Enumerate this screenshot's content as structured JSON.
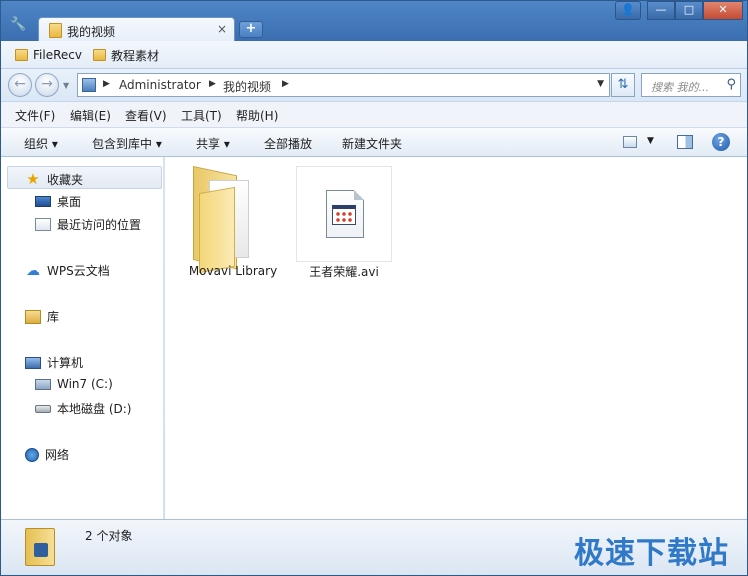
{
  "tab": {
    "title": "我的视频",
    "close": "×"
  },
  "new_tab": "+",
  "caption": {
    "user": "👤",
    "minimize": "—",
    "maximize": "□",
    "close": "✕"
  },
  "favorites": [
    {
      "label": "FileRecv"
    },
    {
      "label": "教程素材"
    }
  ],
  "address": {
    "crumbs": [
      "Administrator",
      "我的视频"
    ],
    "search_placeholder": "搜索 我的..."
  },
  "menu": [
    "文件(F)",
    "编辑(E)",
    "查看(V)",
    "工具(T)",
    "帮助(H)"
  ],
  "toolbar": {
    "organize": "组织",
    "include_library": "包含到库中",
    "share": "共享",
    "play_all": "全部播放",
    "new_folder": "新建文件夹",
    "help": "?"
  },
  "nav": {
    "favorites": "收藏夹",
    "desktop": "桌面",
    "recent": "最近访问的位置",
    "wps_cloud": "WPS云文档",
    "library": "库",
    "computer": "计算机",
    "drive_c": "Win7 (C:)",
    "drive_d": "本地磁盘 (D:)",
    "network": "网络"
  },
  "files": [
    {
      "name": "Movavi Library",
      "type": "folder"
    },
    {
      "name": "王者荣耀.avi",
      "type": "video"
    }
  ],
  "status": {
    "count": "2 个对象"
  },
  "watermark": "极速下载站",
  "colors": {
    "accent": "#3a6eb0",
    "watermark": "#2f79c8"
  }
}
